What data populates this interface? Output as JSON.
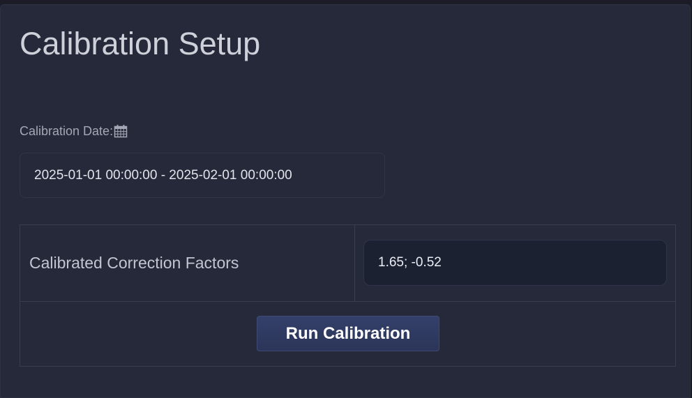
{
  "page": {
    "title": "Calibration Setup"
  },
  "calibration_date": {
    "label": "Calibration Date:",
    "icon": "calendar-icon",
    "value": "2025-01-01 00:00:00 - 2025-02-01 00:00:00"
  },
  "factors": {
    "label": "Calibrated Correction Factors",
    "value": "1.65; -0.52"
  },
  "actions": {
    "run_label": "Run Calibration"
  },
  "colors": {
    "background": "#262939",
    "button": "#2f3a62",
    "input_dark": "#1c2132"
  }
}
